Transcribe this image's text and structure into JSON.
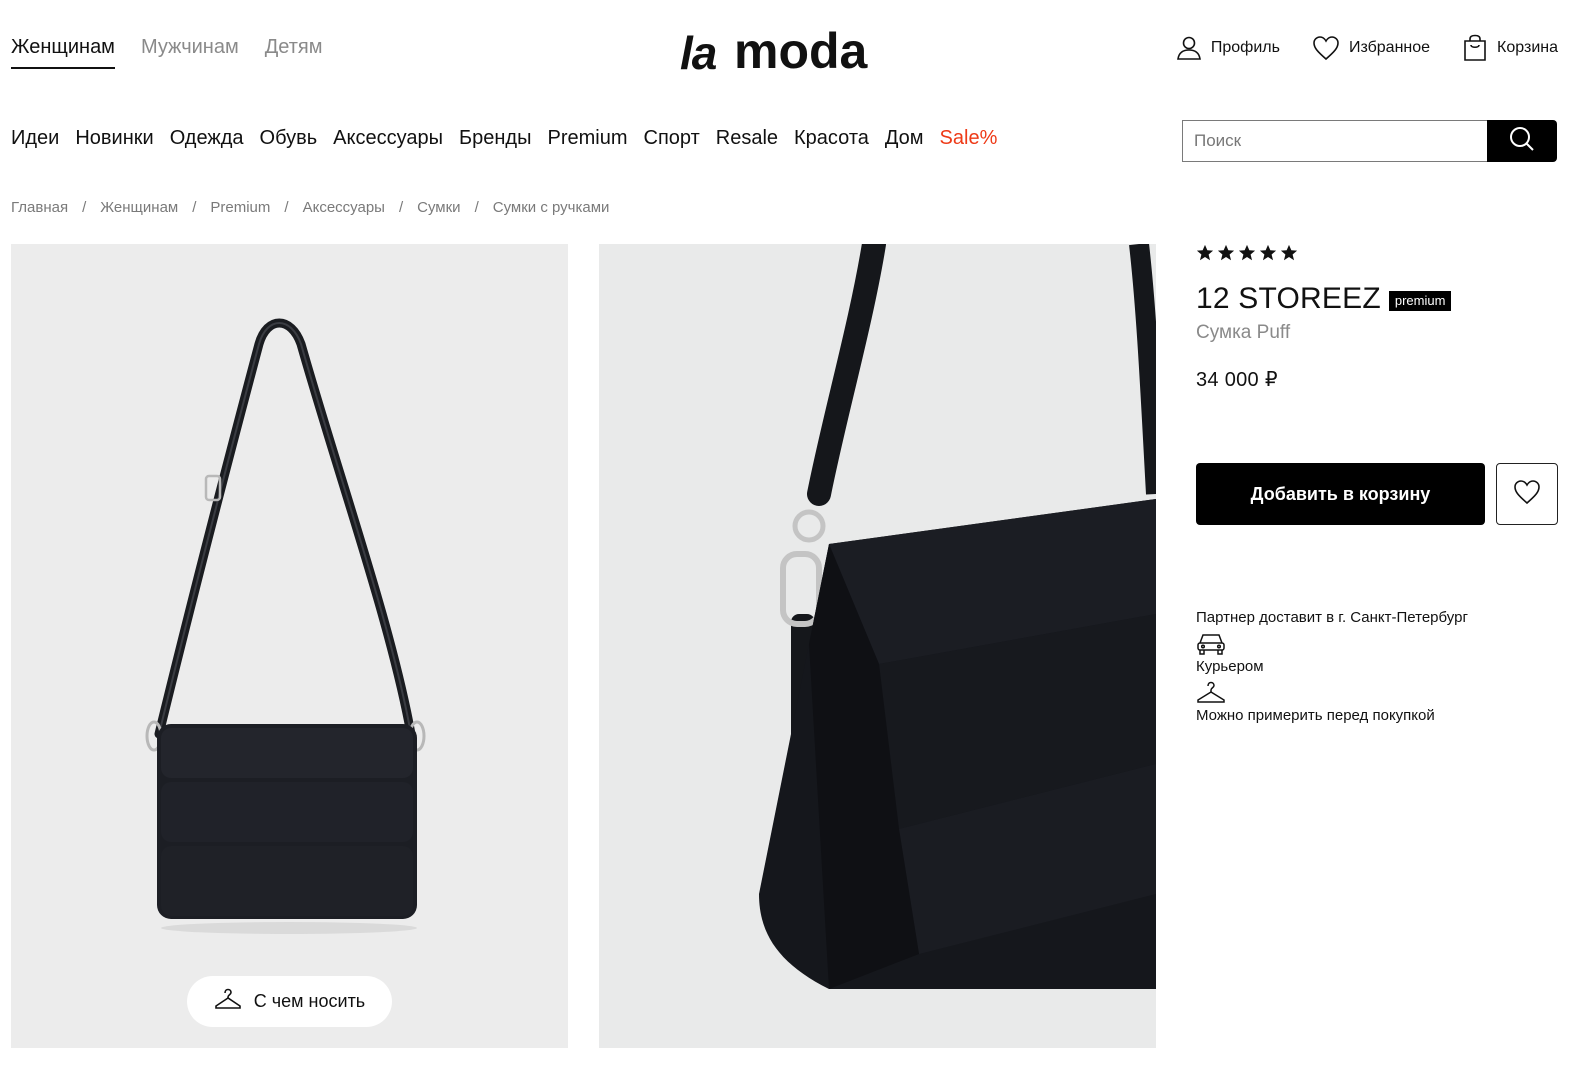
{
  "header": {
    "gender_tabs": [
      {
        "label": "Женщинам",
        "active": true
      },
      {
        "label": "Мужчинам",
        "active": false
      },
      {
        "label": "Детям",
        "active": false
      }
    ],
    "logo": {
      "part1": "la",
      "part2": "moda"
    },
    "user_links": [
      {
        "label": "Профиль",
        "icon": "user-icon"
      },
      {
        "label": "Избранное",
        "icon": "heart-icon"
      },
      {
        "label": "Корзина",
        "icon": "bag-icon"
      }
    ]
  },
  "categories": [
    {
      "label": "Идеи"
    },
    {
      "label": "Новинки"
    },
    {
      "label": "Одежда"
    },
    {
      "label": "Обувь"
    },
    {
      "label": "Аксессуары"
    },
    {
      "label": "Бренды"
    },
    {
      "label": "Premium"
    },
    {
      "label": "Спорт"
    },
    {
      "label": "Resale"
    },
    {
      "label": "Красота"
    },
    {
      "label": "Дом"
    },
    {
      "label": "Sale%",
      "highlight": true
    }
  ],
  "search": {
    "placeholder": "Поиск"
  },
  "breadcrumb": [
    "Главная",
    "Женщинам",
    "Premium",
    "Аксессуары",
    "Сумки",
    "Сумки с ручками"
  ],
  "gallery": {
    "wear_button_label": "С чем носить"
  },
  "product": {
    "rating": 5,
    "brand": "12 STOREEZ",
    "badge": "premium",
    "name": "Сумка Puff",
    "price": "34 000 ₽",
    "add_to_cart_label": "Добавить в корзину"
  },
  "delivery": {
    "partner_text": "Партнер доставит в  г. Санкт-Петербург",
    "courier_label": "Курьером",
    "fitting_label": "Можно примерить перед покупкой"
  },
  "colors": {
    "accent_sale": "#ee3a17",
    "primary": "#000000",
    "muted": "#8a8a8a",
    "photo_bg": "#ececec"
  }
}
